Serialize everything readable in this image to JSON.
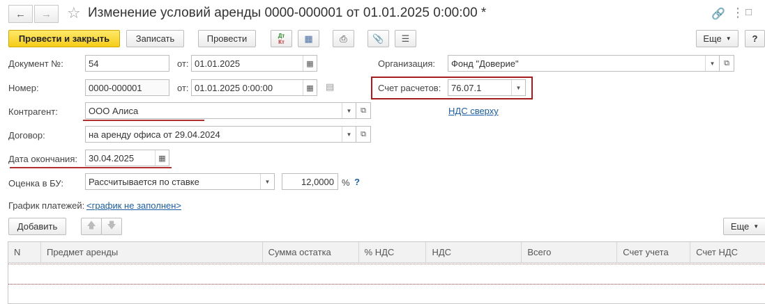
{
  "window": {
    "title": "Изменение условий аренды 0000-000001 от 01.01.2025 0:00:00 *"
  },
  "toolbar": {
    "post_and_close": "Провести и закрыть",
    "save": "Записать",
    "post": "Провести",
    "dt_kt_top": "Дт",
    "dt_kt_bottom": "Кт",
    "more": "Еще",
    "help": "?"
  },
  "form": {
    "doc_number_label": "Документ №:",
    "doc_number_value": "54",
    "from_label": "от:",
    "doc_date_value": "01.01.2025",
    "number_label": "Номер:",
    "number_value": "0000-000001",
    "number_from_label": "от:",
    "number_date_value": "01.01.2025  0:00:00",
    "org_label": "Организация:",
    "org_value": "Фонд \"Доверие\"",
    "account_label": "Счет расчетов:",
    "account_value": "76.07.1",
    "vat_link": "НДС сверху",
    "counterparty_label": "Контрагент:",
    "counterparty_value": "ООО Алиса",
    "contract_label": "Договор:",
    "contract_value": "на аренду офиса от 29.04.2024",
    "end_date_label": "Дата окончания:",
    "end_date_value": "30.04.2025",
    "valuation_label": "Оценка в БУ:",
    "valuation_value": "Рассчитывается по ставке",
    "rate_value": "12,0000",
    "percent_sign": "%",
    "question_mark": "?",
    "schedule_label": "График платежей:",
    "schedule_link": "<график не заполнен>"
  },
  "table_toolbar": {
    "add": "Добавить",
    "more": "Еще"
  },
  "table": {
    "columns": [
      "N",
      "Предмет аренды",
      "Сумма остатка",
      "% НДС",
      "НДС",
      "Всего",
      "Счет учета",
      "Счет НДС"
    ],
    "rows": []
  },
  "colors": {
    "primary_button": "#f5cc18",
    "highlight_red": "#a51c1c",
    "link": "#1a5ea8"
  }
}
